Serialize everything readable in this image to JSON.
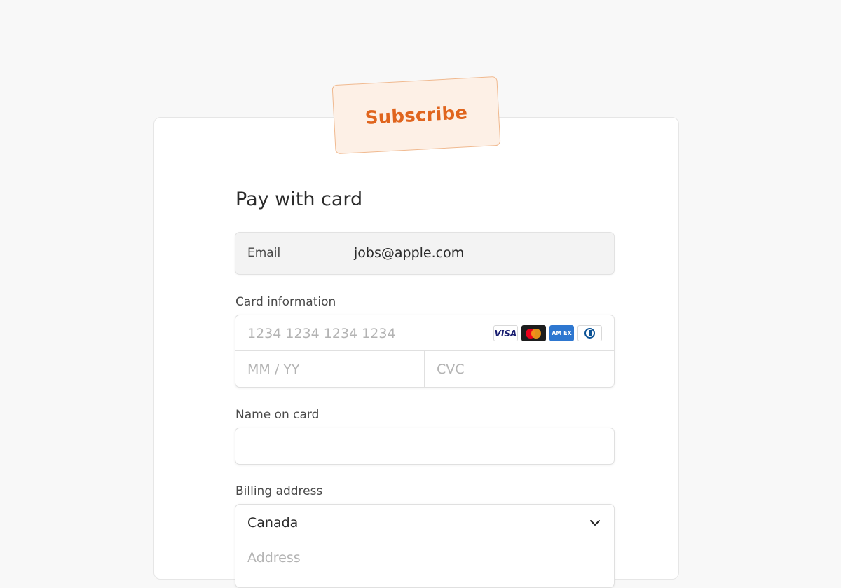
{
  "stamp": {
    "label": "Subscribe"
  },
  "form": {
    "title": "Pay with card",
    "email": {
      "label": "Email",
      "value": "jobs@apple.com"
    },
    "card": {
      "label": "Card information",
      "number_placeholder": "1234 1234 1234 1234",
      "expiry_placeholder": "MM / YY",
      "cvc_placeholder": "CVC",
      "brands": [
        {
          "name": "visa",
          "text": "VISA",
          "icon": "visa-icon"
        },
        {
          "name": "mastercard",
          "icon": "mastercard-icon"
        },
        {
          "name": "amex",
          "text": "AM EX",
          "icon": "amex-icon"
        },
        {
          "name": "diners",
          "icon": "diners-club-icon"
        }
      ]
    },
    "name": {
      "label": "Name on card",
      "value": ""
    },
    "billing": {
      "label": "Billing address",
      "country": "Canada",
      "address_placeholder": "Address"
    }
  },
  "colors": {
    "page_background": "#f8f8f8",
    "stamp_text": "#e0651e",
    "stamp_background": "#fdf0e6"
  }
}
